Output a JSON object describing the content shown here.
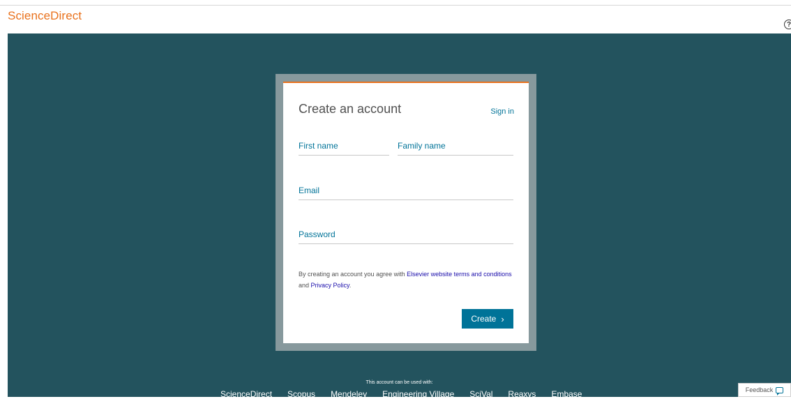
{
  "header": {
    "brand": "ScienceDirect",
    "help_glyph": "?"
  },
  "card": {
    "title": "Create an account",
    "sign_in": "Sign in",
    "first_name_placeholder": "First name",
    "family_name_placeholder": "Family name",
    "email_placeholder": "Email",
    "password_placeholder": "Password",
    "terms_prefix": "By creating an account you agree with ",
    "terms_link": "Elsevier website terms and conditions",
    "terms_and": " and ",
    "privacy_link": "Privacy Policy",
    "terms_suffix": ".",
    "create_label": "Create",
    "create_icon": "›"
  },
  "footer": {
    "used_with": "This account can be used with:",
    "products": [
      "ScienceDirect",
      "Scopus",
      "Mendeley",
      "Engineering Village",
      "SciVal",
      "Reaxys",
      "Embase"
    ]
  },
  "feedback": {
    "label": "Feedback"
  },
  "colors": {
    "brand": "#e9711c",
    "background": "#23535e",
    "accent": "#007398"
  }
}
